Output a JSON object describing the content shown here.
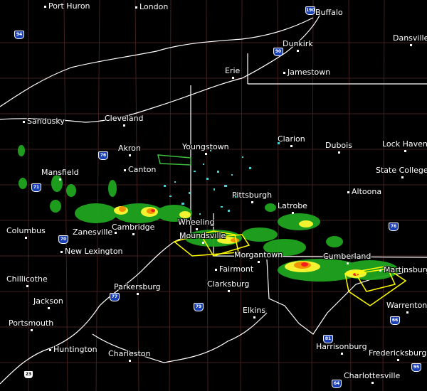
{
  "map": {
    "cities": [
      {
        "id": "port-huron",
        "name": "Port Huron"
      },
      {
        "id": "london",
        "name": "London"
      },
      {
        "id": "buffalo",
        "name": "Buffalo"
      },
      {
        "id": "dunkirk",
        "name": "Dunkirk"
      },
      {
        "id": "dansville",
        "name": "Dansville"
      },
      {
        "id": "erie",
        "name": "Erie"
      },
      {
        "id": "jamestown",
        "name": "Jamestown"
      },
      {
        "id": "sandusky",
        "name": "Sandusky"
      },
      {
        "id": "cleveland",
        "name": "Cleveland"
      },
      {
        "id": "youngstown",
        "name": "Youngstown"
      },
      {
        "id": "clarion",
        "name": "Clarion"
      },
      {
        "id": "dubois",
        "name": "Dubois"
      },
      {
        "id": "lock-haven",
        "name": "Lock Haven"
      },
      {
        "id": "akron",
        "name": "Akron"
      },
      {
        "id": "mansfield",
        "name": "Mansfield"
      },
      {
        "id": "canton",
        "name": "Canton"
      },
      {
        "id": "state-college",
        "name": "State College"
      },
      {
        "id": "pittsburgh",
        "name": "Pittsburgh"
      },
      {
        "id": "altoona",
        "name": "Altoona"
      },
      {
        "id": "latrobe",
        "name": "Latrobe"
      },
      {
        "id": "columbus",
        "name": "Columbus"
      },
      {
        "id": "zanesville",
        "name": "Zanesville"
      },
      {
        "id": "cambridge",
        "name": "Cambridge"
      },
      {
        "id": "wheeling",
        "name": "Wheeling"
      },
      {
        "id": "moundsville",
        "name": "Moundsville"
      },
      {
        "id": "new-lexington",
        "name": "New Lexington"
      },
      {
        "id": "morgantown",
        "name": "Morgantown"
      },
      {
        "id": "cumberland",
        "name": "Cumberland"
      },
      {
        "id": "martinsburg",
        "name": "Martinsburg"
      },
      {
        "id": "chillicothe",
        "name": "Chillicothe"
      },
      {
        "id": "fairmont",
        "name": "Fairmont"
      },
      {
        "id": "parkersburg",
        "name": "Parkersburg"
      },
      {
        "id": "clarksburg",
        "name": "Clarksburg"
      },
      {
        "id": "jackson",
        "name": "Jackson"
      },
      {
        "id": "warrenton",
        "name": "Warrenton"
      },
      {
        "id": "elkins",
        "name": "Elkins"
      },
      {
        "id": "portsmouth",
        "name": "Portsmouth"
      },
      {
        "id": "huntington",
        "name": "Huntington"
      },
      {
        "id": "charleston",
        "name": "Charleston"
      },
      {
        "id": "harrisonburg",
        "name": "Harrisonburg"
      },
      {
        "id": "fredericksburg",
        "name": "Fredericksburg"
      },
      {
        "id": "charlottesville",
        "name": "Charlottesville"
      }
    ],
    "highways": [
      {
        "id": "i94",
        "label": "94"
      },
      {
        "id": "i190",
        "label": "190"
      },
      {
        "id": "i90",
        "label": "90"
      },
      {
        "id": "i76-oh",
        "label": "76"
      },
      {
        "id": "i71",
        "label": "71"
      },
      {
        "id": "i70",
        "label": "70"
      },
      {
        "id": "i76-pa",
        "label": "76"
      },
      {
        "id": "i77",
        "label": "77"
      },
      {
        "id": "i79",
        "label": "79"
      },
      {
        "id": "i81",
        "label": "81"
      },
      {
        "id": "i66",
        "label": "66"
      },
      {
        "id": "i64",
        "label": "64"
      },
      {
        "id": "i95",
        "label": "95"
      },
      {
        "id": "us23",
        "label": "23"
      }
    ],
    "colors": {
      "background": "#000000",
      "state_border": "#ffffff",
      "county_border": "#5a2a2a",
      "warning_polygon": "#ffff00",
      "warning_polygon_green": "#00c000"
    }
  }
}
